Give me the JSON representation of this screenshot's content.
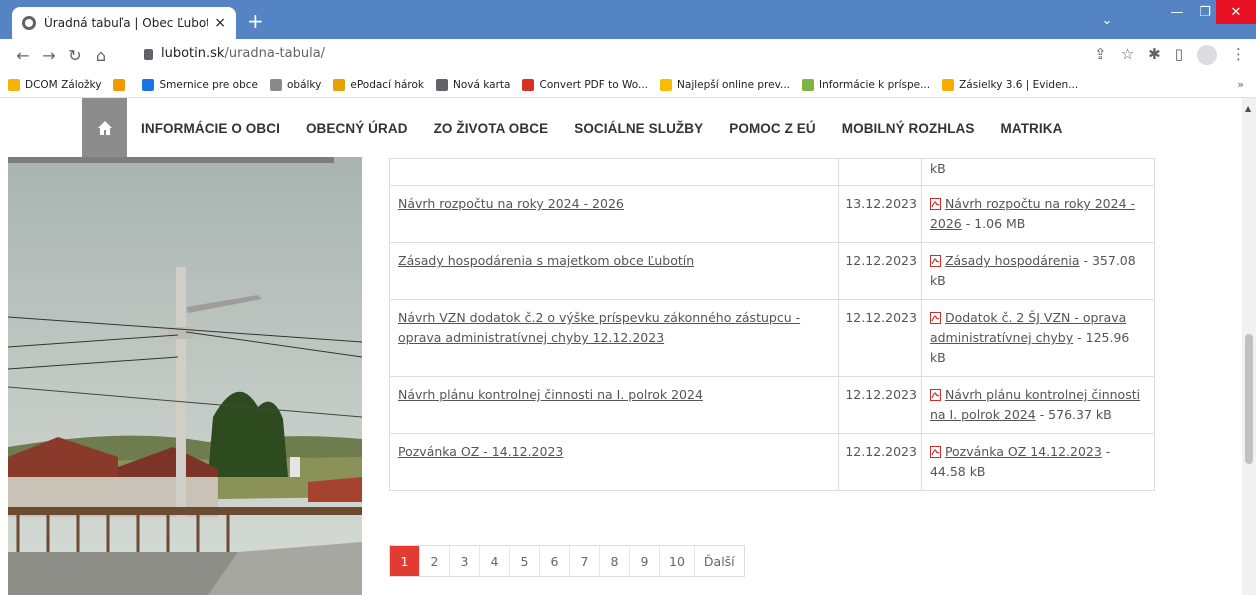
{
  "browser": {
    "tab_title": "Úradná tabuľa | Obec Ľubotín",
    "url_host": "lubotin.sk",
    "url_path": "/uradna-tabula/",
    "bookmarks": [
      {
        "label": "DCOM Záložky",
        "color": "#f4b400"
      },
      {
        "label": "",
        "color": "#f29900"
      },
      {
        "label": "Smernice pre obce",
        "color": "#1a73e8"
      },
      {
        "label": "obálky",
        "color": "#8a8a8a"
      },
      {
        "label": "ePodací hárok",
        "color": "#e6a100"
      },
      {
        "label": "Nová karta",
        "color": "#5f6368"
      },
      {
        "label": "Convert PDF to Wo...",
        "color": "#d93025"
      },
      {
        "label": "Najlepší online prev...",
        "color": "#fbbc04"
      },
      {
        "label": "Informácie k príspe...",
        "color": "#7cb342"
      },
      {
        "label": "Zásielky 3.6 | Eviden...",
        "color": "#f9ab00"
      }
    ],
    "bookmarks_more": "»"
  },
  "nav": {
    "items": [
      "INFORMÁCIE O OBCI",
      "OBECNÝ ÚRAD",
      "ZO ŽIVOTA OBCE",
      "SOCIÁLNE SLUŽBY",
      "POMOC Z EÚ",
      "MOBILNÝ ROZHLAS",
      "MATRIKA"
    ]
  },
  "table": {
    "rows": [
      {
        "title": "",
        "date": "",
        "file": "",
        "size": "kB"
      },
      {
        "title": "Návrh rozpočtu na roky 2024 - 2026",
        "date": "13.12.2023",
        "file": "Návrh rozpočtu na roky 2024 - 2026",
        "size": " - 1.06 MB"
      },
      {
        "title": "Zásady hospodárenia s majetkom obce Ľubotín",
        "date": "12.12.2023",
        "file": "Zásady hospodárenia",
        "size": " - 357.08 kB"
      },
      {
        "title": "Návrh VZN dodatok č.2 o výške príspevku zákonného zástupcu - oprava administratívnej chyby 12.12.2023",
        "date": "12.12.2023",
        "file": "Dodatok č. 2 ŠJ VZN - oprava administratívnej chyby",
        "size": " - 125.96 kB"
      },
      {
        "title": "Návrh plánu kontrolnej činnosti na I. polrok 2024",
        "date": "12.12.2023",
        "file": "Návrh plánu kontrolnej činnosti na I. polrok 2024",
        "size": " - 576.37 kB"
      },
      {
        "title": "Pozvánka OZ - 14.12.2023",
        "date": "12.12.2023",
        "file": "Pozvánka OZ 14.12.2023",
        "size": " - 44.58 kB"
      }
    ]
  },
  "pagination": {
    "pages": [
      "1",
      "2",
      "3",
      "4",
      "5",
      "6",
      "7",
      "8",
      "9",
      "10",
      "Ďalší"
    ],
    "active": "1"
  },
  "colors": {
    "accent": "#e03c31",
    "tabbar": "#5584c4"
  }
}
